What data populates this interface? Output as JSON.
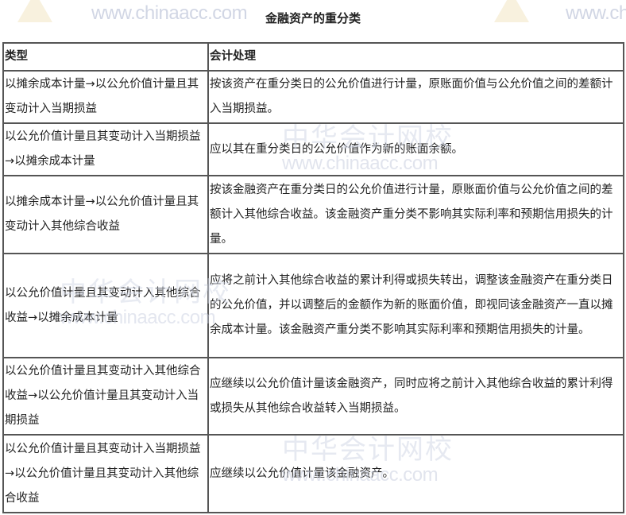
{
  "title": "金融资产的重分类",
  "watermark": {
    "url": "www.chinaacc.com",
    "name": "中华会计网校",
    "url_partial": "www.ch"
  },
  "table": {
    "headers": [
      "类型",
      "会计处理"
    ],
    "rows": [
      {
        "type": "以摊余成本计量→以公允价值计量且其变动计入当期损益",
        "treatment": "按该资产在重分类日的公允价值进行计量，原账面价值与公允价值之间的差额计入当期损益。"
      },
      {
        "type": "以公允价值计量且其变动计入当期损益→以摊余成本计量",
        "treatment": "应以其在重分类日的公允价值作为新的账面余额。"
      },
      {
        "type": "以摊余成本计量→以公允价值计量且其变动计入其他综合收益",
        "treatment": "按该金融资产在重分类日的公允价值进行计量，原账面价值与公允价值之间的差额计入其他综合收益。该金融资产重分类不影响其实际利率和预期信用损失的计量。"
      },
      {
        "type": "以公允价值计量且其变动计入其他综合收益→以摊余成本计量",
        "treatment": "应将之前计入其他综合收益的累计利得或损失转出，调整该金融资产在重分类日的公允价值，并以调整后的金额作为新的账面价值，即视同该金融资产一直以摊余成本计量。该金融资产重分类不影响其实际利率和预期信用损失的计量。"
      },
      {
        "type": "以公允价值计量且其变动计入其他综合收益→以公允价值计量且其变动计入当期损益",
        "treatment": "应继续以公允价值计量该金融资产，同时应将之前计入其他综合收益的累计利得或损失从其他综合收益转入当期损益。"
      },
      {
        "type": "以公允价值计量且其变动计入当期损益→以公允价值计量且其变动计入其他综合收益",
        "treatment": "应继续以公允价值计量该金融资产。"
      }
    ]
  }
}
